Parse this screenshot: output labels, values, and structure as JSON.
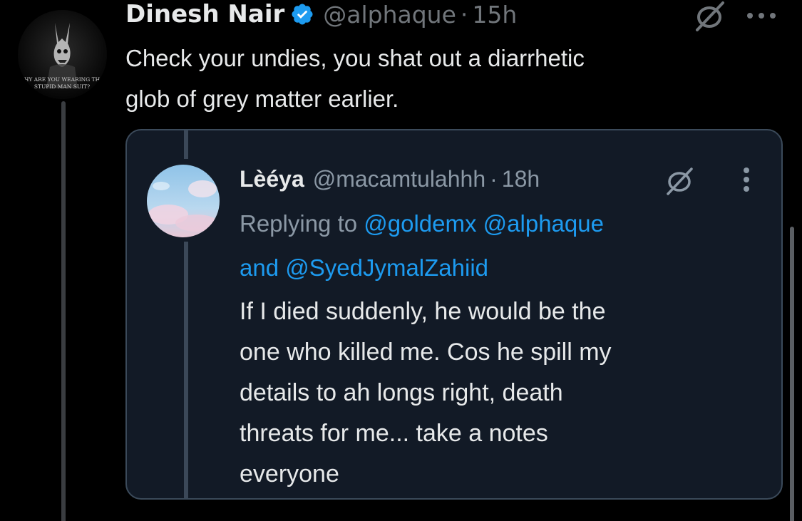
{
  "tweet": {
    "author_name": "Dinesh Nair",
    "handle": "@alphaque",
    "separator": "·",
    "time": "15h",
    "avatar_text_line1": "HY ARE YOU WEARING TH",
    "avatar_text_line2": "STUPID MAN SUIT?",
    "text_lines": [
      "Check your undies, you shat out a diarrhetic",
      "glob of grey matter earlier."
    ],
    "icons": {
      "verified": "verified-badge-icon",
      "grok": "grok-icon",
      "more": "more-horizontal-icon"
    }
  },
  "quote": {
    "author_name": "Lèéya",
    "handle": "@macamtulahhh",
    "separator": "·",
    "time": "18h",
    "replying_prefix": "Replying to ",
    "mention_1": "@goldemx",
    "mention_2": "@alphaque",
    "and_word": "and ",
    "mention_3": "@SyedJymalZahiid",
    "body_lines": [
      "If I died suddenly, he would be the",
      "one who killed me. Cos he spill my",
      "details to ah longs right, death",
      "threats for me... take a notes",
      "everyone"
    ],
    "icons": {
      "grok": "grok-icon",
      "more": "more-vertical-icon"
    }
  },
  "colors": {
    "background": "#000000",
    "card_background": "#121a26",
    "text_primary": "#e7e9ea",
    "text_secondary": "#71767b",
    "link": "#1d9bf0",
    "verified": "#1d9bf0"
  }
}
